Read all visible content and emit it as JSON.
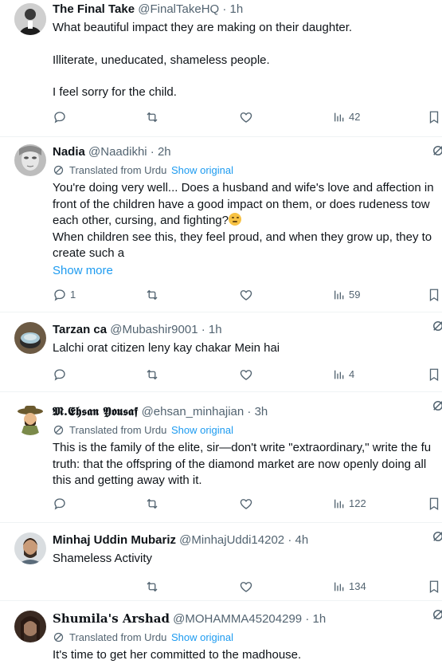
{
  "tweets": [
    {
      "name": "The Final Take",
      "handle": "@FinalTakeHQ",
      "sep": "·",
      "time": "1h",
      "lines": [
        "What beautiful impact they are making on their daughter.",
        "",
        "Illiterate, uneducated, shameless people.",
        "",
        "I feel sorry for the child."
      ],
      "views": "42"
    },
    {
      "name": "Nadia",
      "handle": "@Naadikhi",
      "sep": "·",
      "time": "2h",
      "translated": "Translated from Urdu",
      "show_original": "Show original",
      "lines": [
        "You're doing very well... Does a husband and wife's love and affection in",
        "front of the children have a good impact on them, or does rudeness tow",
        "each other, cursing, and fighting?",
        "When children see this, they feel proud, and when they grow up, they to",
        "create such a"
      ],
      "show_more": "Show more",
      "replies": "1",
      "views": "59"
    },
    {
      "name": "Tarzan ca",
      "handle": "@Mubashir9001",
      "sep": "·",
      "time": "1h",
      "lines": [
        "Lalchi orat citizen leny kay chakar Mein hai"
      ],
      "views": "4"
    },
    {
      "name": "𝕸.𝕰𝖍𝖘𝖆𝖓 𝖄𝖔𝖚𝖘𝖆𝖋",
      "handle": "@ehsan_minhajian",
      "sep": "·",
      "time": "3h",
      "translated": "Translated from Urdu",
      "show_original": "Show original",
      "lines": [
        "This is the family of the elite, sir—don't write \"extraordinary,\" write the fu",
        "truth: that the offspring of the diamond market are now openly doing all",
        "this and getting away with it."
      ],
      "views": "122"
    },
    {
      "name": "Minhaj Uddin Mubariz",
      "handle": "@MinhajUddi14202",
      "sep": "·",
      "time": "4h",
      "lines": [
        "Shameless Activity"
      ],
      "views": "134"
    },
    {
      "name": "𝐒𝐡𝐮𝐦𝐢𝐥𝐚'𝐬 𝐀𝐫𝐬𝐡𝐚𝐝",
      "handle": "@MOHAMMA45204299",
      "sep": "·",
      "time": "1h",
      "translated": "Translated from Urdu",
      "show_original": "Show original",
      "lines": [
        "It's time to get her committed to the madhouse."
      ]
    }
  ],
  "icons": {
    "reply": "reply-icon",
    "retweet": "retweet-icon",
    "like": "like-icon",
    "views": "views-icon",
    "bookmark": "bookmark-icon",
    "grok": "grok-icon",
    "globe": "globe-icon"
  },
  "colors": {
    "link": "#1d9bf0",
    "muted": "#536471",
    "text": "#0f1419"
  }
}
